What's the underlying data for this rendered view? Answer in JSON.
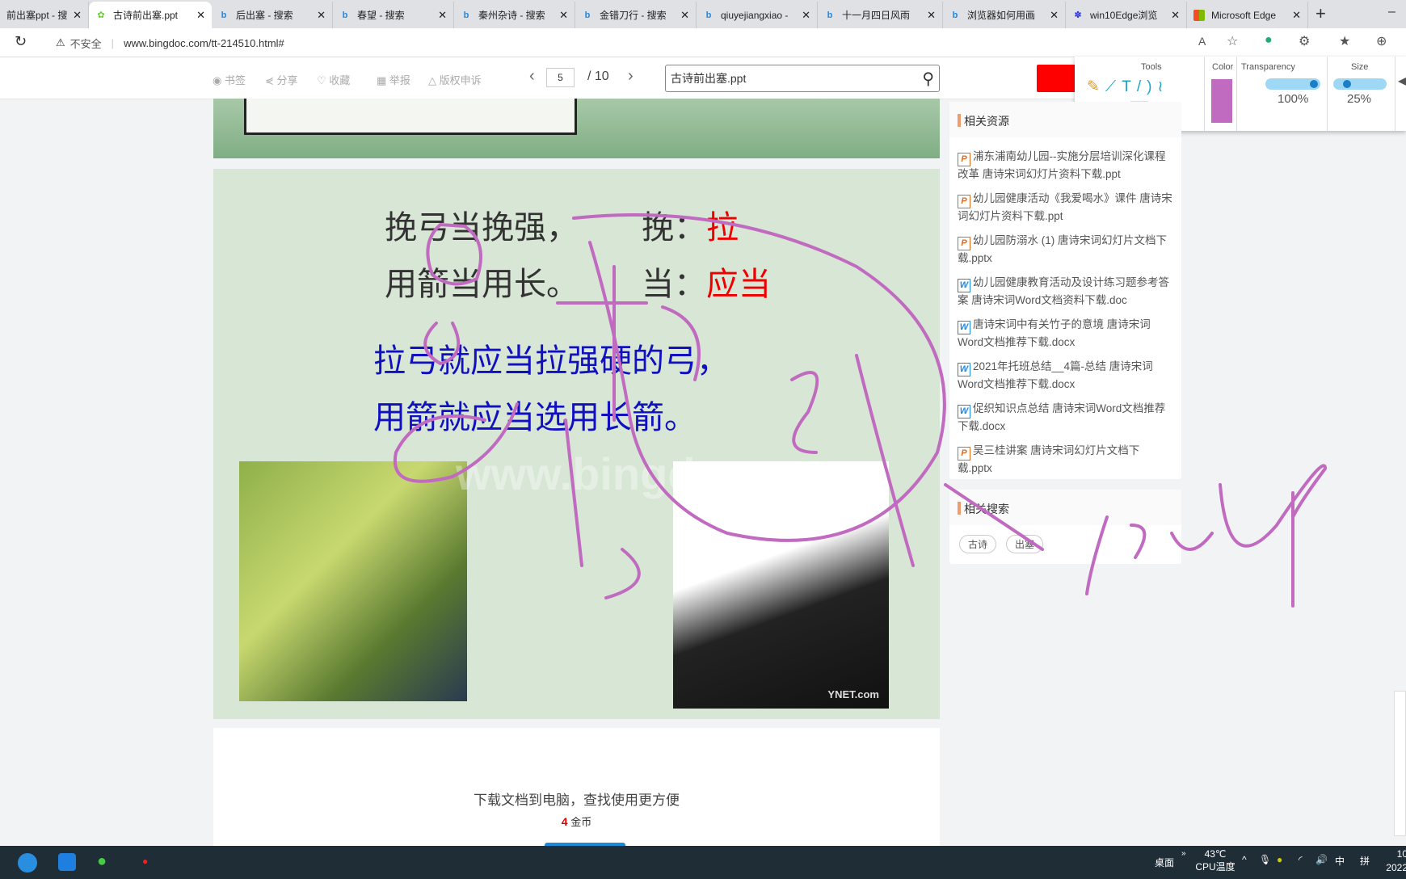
{
  "tabs": [
    {
      "label": "前出塞ppt - 搜索",
      "icon": "bing-icon"
    },
    {
      "label": "古诗前出塞.ppt",
      "icon": "bingdoc-icon",
      "active": true
    },
    {
      "label": "后出塞 - 搜索",
      "icon": "bing-icon"
    },
    {
      "label": "春望 - 搜索",
      "icon": "bing-icon"
    },
    {
      "label": "秦州杂诗 - 搜索",
      "icon": "bing-icon"
    },
    {
      "label": "金错刀行 - 搜索",
      "icon": "bing-icon"
    },
    {
      "label": "qiuyejiangxiao -",
      "icon": "bing-icon"
    },
    {
      "label": "十一月四日风雨",
      "icon": "bing-icon"
    },
    {
      "label": "浏览器如何用画",
      "icon": "bing-icon"
    },
    {
      "label": "win10Edge浏览",
      "icon": "baidu-icon"
    },
    {
      "label": "Microsoft Edge",
      "icon": "microsoft-icon"
    }
  ],
  "address": {
    "security": "不安全",
    "url": "www.bingdoc.com/tt-214510.html#"
  },
  "toolbar": {
    "bookmark": "书签",
    "share": "分享",
    "favorite": "收藏",
    "report": "举报",
    "copyright": "版权申诉",
    "page": "5",
    "total": "/ 10",
    "search": "古诗前出塞.ppt"
  },
  "draw_panel": {
    "tools_label": "Tools",
    "color_label": "Color",
    "transparency_label": "Transparency",
    "size_label": "Size",
    "color": "#c06ac0",
    "transparency": "100%",
    "size": "25%"
  },
  "slide": {
    "line1": "挽弓当挽强，",
    "line2": "用箭当用长。",
    "gloss1_key": "挽：",
    "gloss1_val": "拉",
    "gloss2_key": "当：",
    "gloss2_val": "应当",
    "trans1": "拉弓就应当拉强硬的弓，",
    "trans2": "用箭就应当选用长箭。",
    "watermark": "www.bingdoc.com",
    "photo_caption": "YNET.com"
  },
  "download": {
    "text": "下载文档到电脑，查找使用更方便",
    "coins": "4",
    "coins_unit": "金币"
  },
  "sidebar": {
    "related_title": "相关资源",
    "items": [
      {
        "type": "p",
        "title": "浦东浦南幼儿园--实施分层培训深化课程改革 唐诗宋词幻灯片资料下载.ppt"
      },
      {
        "type": "p",
        "title": "幼儿园健康活动《我爱喝水》课件 唐诗宋词幻灯片资料下载.ppt"
      },
      {
        "type": "p",
        "title": "幼儿园防溺水 (1) 唐诗宋词幻灯片文档下载.pptx"
      },
      {
        "type": "w",
        "title": "幼儿园健康教育活动及设计练习题参考答案 唐诗宋词Word文档资料下载.doc"
      },
      {
        "type": "w",
        "title": "唐诗宋词中有关竹子的意境 唐诗宋词Word文档推荐下载.docx"
      },
      {
        "type": "w",
        "title": "2021年托班总结__4篇-总结 唐诗宋词Word文档推荐下载.docx"
      },
      {
        "type": "w",
        "title": "促织知识点总结 唐诗宋词Word文档推荐下载.docx"
      },
      {
        "type": "p",
        "title": "吴三桂讲案 唐诗宋词幻灯片文档下载.pptx"
      }
    ],
    "search_title": "相关搜索",
    "tags": [
      "古诗",
      "出塞"
    ]
  },
  "taskbar": {
    "desktop": "桌面",
    "temp": "43℃",
    "temp_label": "CPU温度",
    "ime": "中",
    "ime2": "拼",
    "time": "10",
    "date": "2022"
  }
}
